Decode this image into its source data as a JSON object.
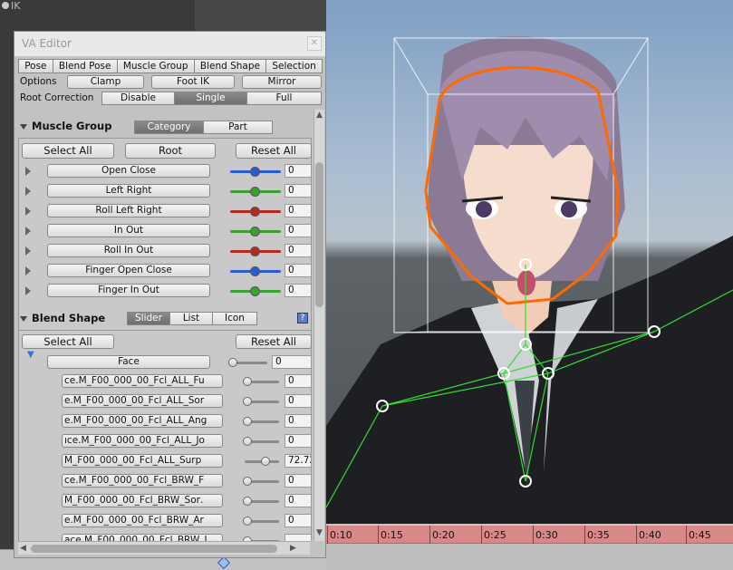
{
  "background": {
    "ik_label": "IK"
  },
  "editor": {
    "title": "VA Editor",
    "close_icon": "close-icon",
    "tabs": [
      "Pose",
      "Blend Pose",
      "Muscle Group",
      "Blend Shape",
      "Selection"
    ],
    "options": {
      "label": "Options",
      "buttons": [
        "Clamp",
        "Foot IK",
        "Mirror"
      ]
    },
    "root_correction": {
      "label": "Root Correction",
      "modes": [
        "Disable",
        "Single",
        "Full"
      ],
      "selected": "Single"
    },
    "muscle_group": {
      "title": "Muscle Group",
      "toggle": [
        "Category",
        "Part"
      ],
      "toggle_selected": "Category",
      "select_all": "Select All",
      "root": "Root",
      "reset_all": "Reset All",
      "rows": [
        {
          "label": "Open Close",
          "value": "0",
          "color": "#2a5bd7"
        },
        {
          "label": "Left Right",
          "value": "0",
          "color": "#3aa12e"
        },
        {
          "label": "Roll Left Right",
          "value": "0",
          "color": "#b8281f"
        },
        {
          "label": "In Out",
          "value": "0",
          "color": "#3aa12e"
        },
        {
          "label": "Roll In Out",
          "value": "0",
          "color": "#b8281f"
        },
        {
          "label": "Finger Open Close",
          "value": "0",
          "color": "#2a5bd7"
        },
        {
          "label": "Finger In Out",
          "value": "0",
          "color": "#3aa12e"
        }
      ]
    },
    "blend_shape": {
      "title": "Blend Shape",
      "toggle": [
        "Slider",
        "List",
        "Icon"
      ],
      "toggle_selected": "Slider",
      "help_icon": "help-icon",
      "select_all": "Select All",
      "reset_all": "Reset All",
      "group": {
        "label": "Face",
        "value": "0"
      },
      "rows": [
        {
          "label": "ce.M_F00_000_00_Fcl_ALL_Fu",
          "value": "0",
          "level": 0
        },
        {
          "label": "e.M_F00_000_00_Fcl_ALL_Sor",
          "value": "0",
          "level": 0
        },
        {
          "label": "e.M_F00_000_00_Fcl_ALL_Ang",
          "value": "0",
          "level": 0
        },
        {
          "label": "ıce.M_F00_000_00_Fcl_ALL_Jo",
          "value": "0",
          "level": 0
        },
        {
          "label": "M_F00_000_00_Fcl_ALL_Surp",
          "value": "72.72",
          "level": 0.7272
        },
        {
          "label": "ce.M_F00_000_00_Fcl_BRW_F",
          "value": "0",
          "level": 0
        },
        {
          "label": ".M_F00_000_00_Fcl_BRW_Sor",
          "value": "0",
          "level": 0
        },
        {
          "label": "e.M_F00_000_00_Fcl_BRW_Ar",
          "value": "0",
          "level": 0
        },
        {
          "label": "ace.M_F00_000_00_Fcl_BRW_J",
          "value": "",
          "level": 0
        }
      ]
    }
  },
  "timeline": {
    "ticks": [
      "0:10",
      "0:15",
      "0:20",
      "0:25",
      "0:30",
      "0:35",
      "0:40",
      "0:45"
    ]
  }
}
